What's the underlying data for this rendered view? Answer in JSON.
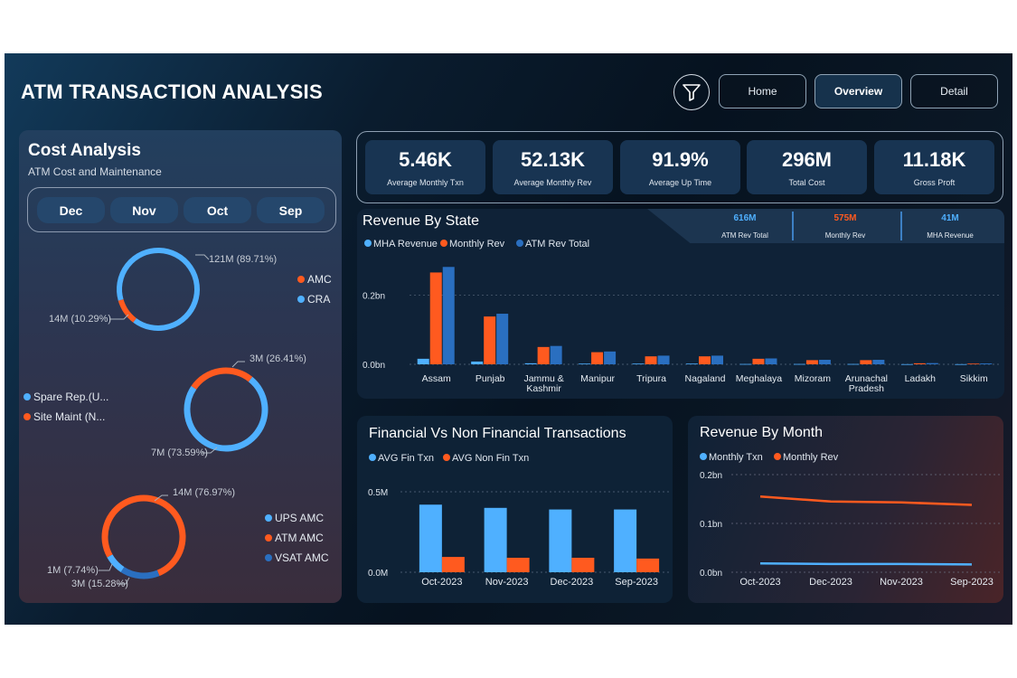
{
  "app_title": "ATM TRANSACTION ANALYSIS",
  "nav": {
    "home": "Home",
    "overview": "Overview",
    "detail": "Detail"
  },
  "icons": {
    "filter": "filter-icon"
  },
  "colors": {
    "blue": "#4fb0ff",
    "orange": "#ff5a1f",
    "darkblue": "#2a6fc0"
  },
  "cost": {
    "title": "Cost Analysis",
    "subtitle": "ATM Cost and Maintenance",
    "months": [
      "Dec",
      "Nov",
      "Oct",
      "Sep"
    ],
    "donut1": {
      "label_big": "121M (89.71%)",
      "label_small": "14M (10.29%)",
      "legend": [
        "AMC",
        "CRA"
      ],
      "values": [
        89.71,
        10.29
      ]
    },
    "donut2": {
      "label_small": "3M (26.41%)",
      "label_big": "7M (73.59%)",
      "legend": [
        "Spare Rep.(U...",
        "Site Maint (N..."
      ],
      "values": [
        26.41,
        73.59
      ]
    },
    "donut3": {
      "label_big": "14M (76.97%)",
      "label_a": "1M (7.74%)",
      "label_b": "3M (15.28%)",
      "legend": [
        "UPS AMC",
        "ATM AMC",
        "VSAT AMC"
      ],
      "values": [
        7.74,
        76.97,
        15.28
      ]
    }
  },
  "kpis": [
    {
      "value": "5.46K",
      "label": "Average Monthly Txn"
    },
    {
      "value": "52.13K",
      "label": "Average Monthly Rev"
    },
    {
      "value": "91.9%",
      "label": "Average Up Time"
    },
    {
      "value": "296M",
      "label": "Total Cost"
    },
    {
      "value": "11.18K",
      "label": "Gross Proft"
    }
  ],
  "rev_tabs": [
    {
      "value": "616M",
      "label": "ATM Rev Total",
      "color": "#4fb0ff"
    },
    {
      "value": "575M",
      "label": "Monthly Rev",
      "color": "#ff5a1f"
    },
    {
      "value": "41M",
      "label": "MHA Revenue",
      "color": "#4fb0ff"
    }
  ],
  "chart_data": [
    {
      "type": "bar",
      "title": "Revenue By State",
      "categories": [
        "Assam",
        "Punjab",
        "Jammu & Kashmir",
        "Manipur",
        "Tripura",
        "Nagaland",
        "Meghalaya",
        "Mizoram",
        "Arunachal Pradesh",
        "Ladakh",
        "Sikkim"
      ],
      "category_lines": [
        [
          "Assam"
        ],
        [
          "Punjab"
        ],
        [
          "Jammu &",
          "Kashmir"
        ],
        [
          "Manipur"
        ],
        [
          "Tripura"
        ],
        [
          "Nagaland"
        ],
        [
          "Meghalaya"
        ],
        [
          "Mizoram"
        ],
        [
          "Arunachal",
          "Pradesh"
        ],
        [
          "Ladakh"
        ],
        [
          "Sikkim"
        ]
      ],
      "series": [
        {
          "name": "MHA Revenue",
          "color": "#4fb0ff",
          "values": [
            0.016,
            0.008,
            0.003,
            0.002,
            0.002,
            0.002,
            0.001,
            0.001,
            0.001,
            0.0005,
            0.0005
          ]
        },
        {
          "name": "Monthly Rev",
          "color": "#ff5a1f",
          "values": [
            0.265,
            0.138,
            0.05,
            0.035,
            0.023,
            0.023,
            0.016,
            0.012,
            0.012,
            0.003,
            0.002
          ]
        },
        {
          "name": "ATM Rev Total",
          "color": "#2a6fc0",
          "values": [
            0.281,
            0.146,
            0.053,
            0.037,
            0.025,
            0.025,
            0.017,
            0.013,
            0.013,
            0.0035,
            0.0025
          ]
        }
      ],
      "yticks": [
        "0.0bn",
        "0.2bn"
      ],
      "ylim": [
        0,
        0.3
      ]
    },
    {
      "type": "bar",
      "title": "Financial Vs Non Financial Transactions",
      "categories": [
        "Oct-2023",
        "Nov-2023",
        "Dec-2023",
        "Sep-2023"
      ],
      "series": [
        {
          "name": "AVG Fin Txn",
          "color": "#4fb0ff",
          "values": [
            0.42,
            0.4,
            0.39,
            0.39
          ]
        },
        {
          "name": "AVG Non Fin Txn",
          "color": "#ff5a1f",
          "values": [
            0.095,
            0.09,
            0.09,
            0.085
          ]
        }
      ],
      "yticks": [
        "0.0M",
        "0.5M"
      ],
      "ylim": [
        0,
        0.55
      ]
    },
    {
      "type": "line",
      "title": "Revenue By Month",
      "categories": [
        "Oct-2023",
        "Dec-2023",
        "Nov-2023",
        "Sep-2023"
      ],
      "series": [
        {
          "name": "Monthly Txn",
          "color": "#4fb0ff",
          "values": [
            0.018,
            0.017,
            0.017,
            0.016
          ]
        },
        {
          "name": "Monthly Rev",
          "color": "#ff5a1f",
          "values": [
            0.155,
            0.145,
            0.143,
            0.138
          ]
        }
      ],
      "yticks": [
        "0.0bn",
        "0.1bn",
        "0.2bn"
      ],
      "ylim": [
        0,
        0.2
      ]
    }
  ]
}
